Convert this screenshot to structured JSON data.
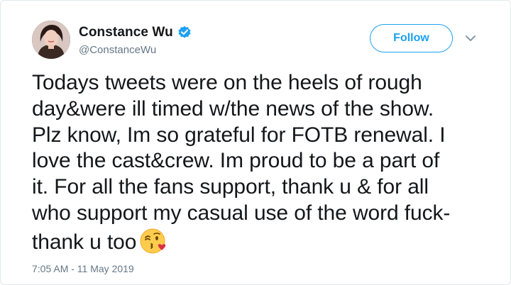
{
  "author": {
    "display_name": "Constance Wu",
    "handle": "@ConstanceWu",
    "verified": true,
    "avatar_icon": "profile-photo"
  },
  "actions": {
    "follow_label": "Follow",
    "more_icon": "chevron-down-icon"
  },
  "tweet": {
    "lines": [
      "Todays tweets were on the heels of rough",
      "day&were ill timed w/the news of the show.",
      "Plz know, Im so grateful for FOTB renewal. I",
      "love the cast&crew. Im proud to be a part of",
      "it. For all the fans support, thank u & for all",
      "who support my casual use of the word fuck-",
      "thank u too"
    ],
    "emoji": "face-blowing-a-kiss"
  },
  "timestamp": "7:05 AM - 11 May 2019",
  "colors": {
    "accent": "#1da1f2",
    "text": "#14171a",
    "muted": "#657786",
    "border": "#e1e8ed"
  }
}
